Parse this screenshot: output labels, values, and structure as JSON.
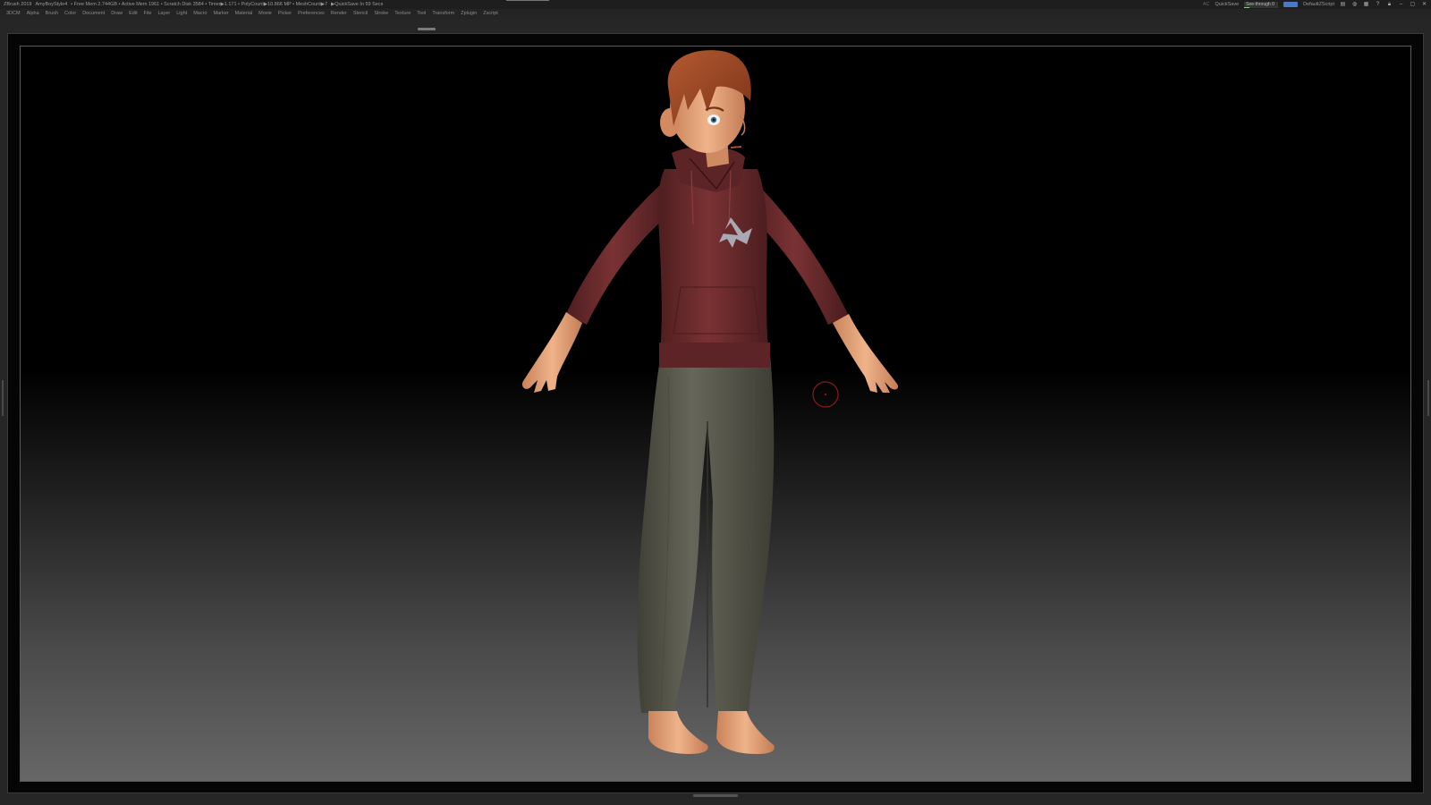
{
  "titlebar": {
    "app": "ZBrush 2019",
    "project": "AmyBoyStyle4",
    "stats": "• Free Mem 2.744GB • Active Mem 1961 • Scratch Disk 3584 • Timer▶1.171 • PolyCount▶10.866 MP • MeshCount▶7",
    "quicksave_status": "▶QuickSave In 59 Secs",
    "ac_label": "AC",
    "quicksave_button": "QuickSave",
    "see_through_label": "See-through",
    "see_through_value": "0",
    "script_label": "DefaultZScript",
    "icons": [
      "menus-icon",
      "interface-icon",
      "layout-icon",
      "help-icon",
      "lock-icon",
      "minimize-icon",
      "restore-icon",
      "close-icon"
    ]
  },
  "menubar": {
    "items": [
      "3DCM",
      "Alpha",
      "Brush",
      "Color",
      "Document",
      "Draw",
      "Edit",
      "File",
      "Layer",
      "Light",
      "Macro",
      "Marker",
      "Material",
      "Movie",
      "Picker",
      "Preferences",
      "Render",
      "Stencil",
      "Stroke",
      "Texture",
      "Tool",
      "Transform",
      "Zplugin",
      "Zscript"
    ]
  },
  "colors": {
    "hoodie": "#6a2a2c",
    "pants": "#5a5a4c",
    "skin": "#e1a075",
    "hair": "#9a4526",
    "logo": "#a9a9b1",
    "cursor": "#8a1a1a"
  }
}
